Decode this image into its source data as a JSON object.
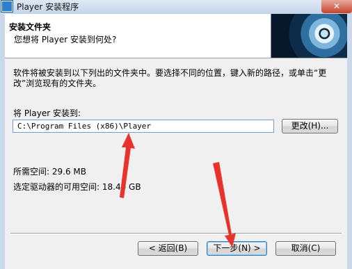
{
  "window": {
    "title": "Player 安装程序",
    "close_symbol": "✕"
  },
  "header": {
    "title": "安装文件夹",
    "subtitle": "您想将 Player 安装到何处?"
  },
  "body": {
    "description": "软件将被安装到以下列出的文件夹中。要选择不同的位置，键入新的路径，或单击“更改”浏览现有的文件夹。",
    "install_to_label": "将 Player 安装到:",
    "install_path": "C:\\Program Files (x86)\\Player",
    "change_button": "更改(H)...",
    "space_required_label": "所需空间: 29.6 MB",
    "space_available_label": "选定驱动器的可用空间: 18.40 GB"
  },
  "footer": {
    "back_button": "< 返回(B)",
    "next_button": "下一步(N) >",
    "cancel_button": "取消(C)"
  },
  "colors": {
    "annotation_arrow": "#e8322b",
    "default_button_border": "#3c7fb1"
  },
  "icons": {
    "app": "app-icon",
    "banner": "cd-disc-image"
  }
}
